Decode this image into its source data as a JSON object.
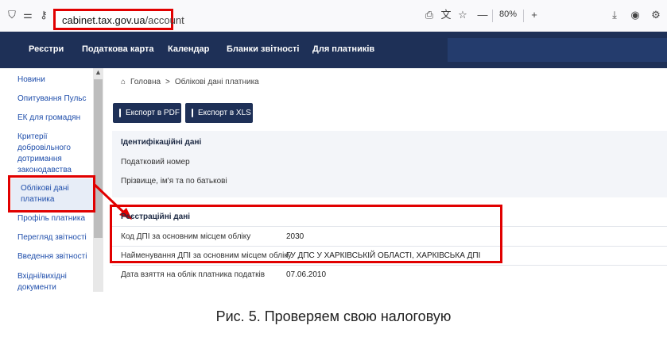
{
  "browser": {
    "url_host": "cabinet.tax.gov.ua",
    "url_path": "/account",
    "zoom": "80%"
  },
  "nav": {
    "items": [
      "Реєстри",
      "Податкова карта",
      "Календар",
      "Бланки звітності",
      "Для платників"
    ]
  },
  "sidebar": {
    "items": [
      "Новини",
      "Опитування Пульс",
      "ЕК для громадян",
      "Критерії добровільного дотримання законодавства",
      "Облікові дані платника",
      "Профіль платника",
      "Перегляд звітності",
      "Введення звітності",
      "Вхідні/вихідні документи"
    ]
  },
  "breadcrumb": {
    "home": "Головна",
    "separator": ">",
    "current": "Облікові дані платника"
  },
  "toolbar": {
    "export_pdf": "Експорт в PDF",
    "export_xls": "Експорт в XLS"
  },
  "identification": {
    "title": "Ідентифікаційні дані",
    "tax_number_label": "Податковий номер",
    "name_label": "Прізвище, ім'я та по батькові"
  },
  "registration": {
    "title": "Реєстраційні дані",
    "dps_code_label": "Код ДПІ за основним місцем обліку",
    "dps_code_value": "2030",
    "dps_name_label": "Найменування ДПІ за основним місцем обліку",
    "dps_name_value": "ГУ ДПС У ХАРКІВСЬКІЙ ОБЛАСТІ, ХАРКІВСЬКА ДПІ",
    "reg_date_label": "Дата взяття на облік платника податків",
    "reg_date_value": "07.06.2010"
  },
  "caption": "Рис. 5. Проверяем свою налоговую",
  "colors": {
    "nav_bg": "#1e3057",
    "highlight": "#e10000",
    "link": "#1f4eab"
  }
}
